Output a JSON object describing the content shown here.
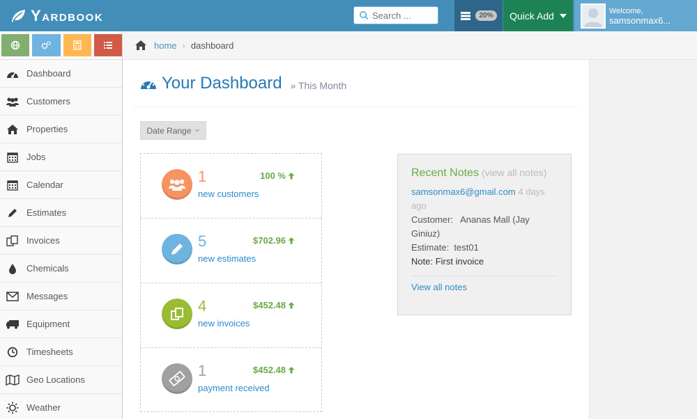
{
  "brand": {
    "name": "Yardbook"
  },
  "search": {
    "placeholder": "Search ..."
  },
  "tasks": {
    "badge": "20%"
  },
  "quick_add": {
    "label": "Quick Add"
  },
  "user": {
    "welcome": "Welcome,",
    "name": "samsonmax6..."
  },
  "sidebar": {
    "items": [
      {
        "label": "Dashboard",
        "icon": "dashboard-icon"
      },
      {
        "label": "Customers",
        "icon": "users-icon"
      },
      {
        "label": "Properties",
        "icon": "home-icon"
      },
      {
        "label": "Jobs",
        "icon": "calendar-icon"
      },
      {
        "label": "Calendar",
        "icon": "calendar-icon"
      },
      {
        "label": "Estimates",
        "icon": "pencil-icon"
      },
      {
        "label": "Invoices",
        "icon": "copy-icon"
      },
      {
        "label": "Chemicals",
        "icon": "drop-icon"
      },
      {
        "label": "Messages",
        "icon": "envelope-icon"
      },
      {
        "label": "Equipment",
        "icon": "truck-icon"
      },
      {
        "label": "Timesheets",
        "icon": "clock-icon"
      },
      {
        "label": "Geo Locations",
        "icon": "map-icon"
      },
      {
        "label": "Weather",
        "icon": "sun-icon"
      }
    ]
  },
  "breadcrumb": {
    "home": "home",
    "current": "dashboard"
  },
  "header": {
    "title": "Your Dashboard",
    "subtitle": "» This Month"
  },
  "date_range": {
    "label": "Date Range"
  },
  "stats": [
    {
      "value": "1",
      "label": "new customers",
      "change": "100 %",
      "color": "#f79263"
    },
    {
      "value": "5",
      "label": "new estimates",
      "change": "$702.96",
      "color": "#6fb3e0"
    },
    {
      "value": "4",
      "label": "new invoices",
      "change": "$452.48",
      "color": "#9abc32"
    },
    {
      "value": "1",
      "label": "payment received",
      "change": "$452.48",
      "color": "#a0a0a0"
    }
  ],
  "notes": {
    "title": "Recent Notes",
    "view_all_link": "(view all notes)",
    "email": "samsonmax6@gmail.com",
    "ago": "4 days ago",
    "customer_label": "Customer:",
    "customer": "Ananas Mall (Jay Giniuz)",
    "estimate_label": "Estimate:",
    "estimate": "test01",
    "note_label": "Note:",
    "note": "First invoice",
    "view_all": "View all notes"
  }
}
